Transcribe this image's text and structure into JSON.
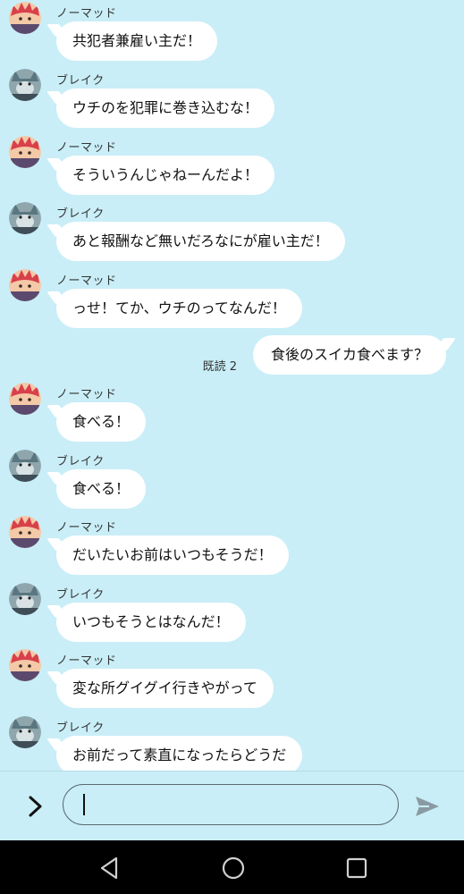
{
  "messages": [
    {
      "sender": "ノーマッド",
      "text": "共犯者兼雇い主だ！",
      "avatar": "nomad-avatar"
    },
    {
      "sender": "ブレイク",
      "text": "ウチのを犯罪に巻き込むな！",
      "avatar": "blake-avatar"
    },
    {
      "sender": "ノーマッド",
      "text": "そういうんじゃねーんだよ！",
      "avatar": "nomad-avatar"
    },
    {
      "sender": "ブレイク",
      "text": "あと報酬など無いだろなにが雇い主だ！",
      "avatar": "blake-avatar"
    },
    {
      "sender": "ノーマッド",
      "text": "っせ！てか、ウチのってなんだ！",
      "avatar": "nomad-avatar"
    },
    {
      "outgoing": true,
      "text": "食後のスイカ食べます？",
      "read": "既読 2"
    },
    {
      "sender": "ノーマッド",
      "text": "食べる！",
      "avatar": "nomad-avatar"
    },
    {
      "sender": "ブレイク",
      "text": "食べる！",
      "avatar": "blake-avatar"
    },
    {
      "sender": "ノーマッド",
      "text": "だいたいお前はいつもそうだ！",
      "avatar": "nomad-avatar"
    },
    {
      "sender": "ブレイク",
      "text": "いつもそうとはなんだ！",
      "avatar": "blake-avatar"
    },
    {
      "sender": "ノーマッド",
      "text": "変な所グイグイ行きやがって",
      "avatar": "nomad-avatar"
    },
    {
      "sender": "ブレイク",
      "text": "お前だって素直になったらどうだ",
      "avatar": "blake-avatar"
    }
  ],
  "input": {
    "value": "",
    "placeholder": ""
  },
  "colors": {
    "chat_background": "#c9eef7",
    "bubble": "#ffffff",
    "nomad_hair": "#d8404a",
    "blake_fur": "#5a7680",
    "nav_background": "#000000"
  },
  "icons": {
    "expand": "chevron-right-icon",
    "send": "send-icon",
    "nav_back": "back-triangle-icon",
    "nav_home": "home-circle-icon",
    "nav_recents": "recents-square-icon"
  }
}
